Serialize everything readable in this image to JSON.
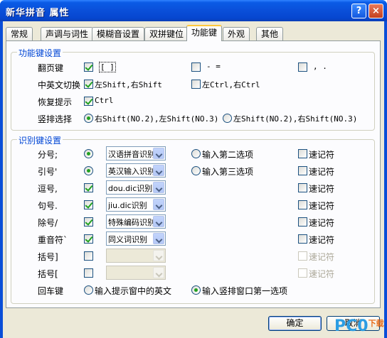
{
  "window": {
    "title": "新华拼音 属性",
    "help": "?",
    "close": "×"
  },
  "tabs": [
    "常规",
    "声调与词性",
    "模糊音设置",
    "双拼键位",
    "功能键",
    "外观",
    "其他"
  ],
  "function_keys": {
    "group_title": "功能键设置",
    "page_flip": {
      "label": "翻页键",
      "opt1": "[ ]",
      "opt2": "- =",
      "opt3": ", ."
    },
    "cn_en_switch": {
      "label": "中英文切换",
      "opt1": "左Shift,右Shift",
      "opt2": "左Ctrl,右Ctrl"
    },
    "restore_hint": {
      "label": "恢复提示",
      "opt1": "Ctrl"
    },
    "vertical_select": {
      "label": "竖排选择",
      "opt1": "右Shift(NO.2),左Shift(NO.3)",
      "opt2": "左Shift(NO.2),右Shift(NO.3)"
    }
  },
  "recognize_keys": {
    "group_title": "识别键设置",
    "rows": [
      {
        "label": "分号;",
        "combo": "汉语拼音识别",
        "option": "输入第二选项",
        "memo": "速记符"
      },
      {
        "label": "引号'",
        "combo": "英汉输入识别",
        "option": "输入第三选项",
        "memo": "速记符"
      },
      {
        "label": "逗号,",
        "combo": "dou.dic识别",
        "memo": "速记符"
      },
      {
        "label": "句号.",
        "combo": "jiu.dic识别",
        "memo": "速记符"
      },
      {
        "label": "除号/",
        "combo": "特殊编码识别",
        "memo": "速记符"
      },
      {
        "label": "重音符`",
        "combo": "同义词识别",
        "memo": "速记符"
      },
      {
        "label": "括号]",
        "combo": "",
        "memo": "速记符"
      },
      {
        "label": "括号[",
        "combo": "",
        "memo": "速记符"
      }
    ],
    "enter_key": {
      "label": "回车键",
      "opt1": "输入提示窗中的英文",
      "opt2": "输入竖排窗口第一选项"
    }
  },
  "buttons": {
    "ok": "确定",
    "cancel": "取消"
  },
  "watermark": {
    "text": "PC0",
    "suffix": "下载"
  }
}
